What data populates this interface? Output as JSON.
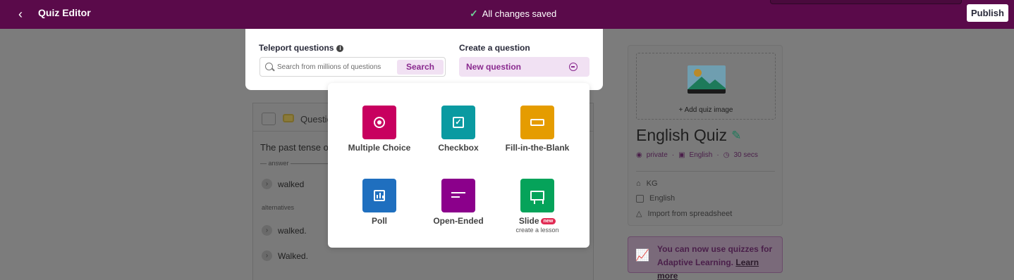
{
  "header": {
    "title": "Quiz Editor",
    "save_status": "All changes saved",
    "publish_label": "Publish"
  },
  "teleport": {
    "label": "Teleport questions",
    "placeholder": "Search from millions of questions",
    "search_label": "Search"
  },
  "create": {
    "label": "Create a question",
    "new_question_label": "New question"
  },
  "question_types": [
    {
      "name": "Multiple Choice",
      "icon": "radio-target-icon",
      "color": "#c8005f"
    },
    {
      "name": "Checkbox",
      "icon": "checkbox-icon",
      "color": "#0a9aa1"
    },
    {
      "name": "Fill-in-the-Blank",
      "icon": "blank-box-icon",
      "color": "#e59c00"
    },
    {
      "name": "Poll",
      "icon": "bar-chart-icon",
      "color": "#1f6fbf"
    },
    {
      "name": "Open-Ended",
      "icon": "text-lines-icon",
      "color": "#8b008b"
    },
    {
      "name": "Slide",
      "icon": "presentation-board-icon",
      "color": "#05a35a",
      "badge": "new",
      "subtitle": "create a lesson"
    }
  ],
  "question_card": {
    "header_label": "Questio",
    "text": "The past tense o",
    "answer_label": "answer",
    "answer": "walked",
    "alternatives_label": "alternatives",
    "alternatives": [
      "walked.",
      "Walked."
    ]
  },
  "quiz_panel": {
    "add_image_label": "+ Add quiz image",
    "title": "English Quiz",
    "visibility": "private",
    "language": "English",
    "duration": "30 secs",
    "grade": "KG",
    "subject": "English",
    "import_label": "Import from spreadsheet"
  },
  "adaptive": {
    "text": "You can now use quizzes for Adaptive Learning.",
    "link": "Learn more"
  },
  "colors": {
    "topbar": "#5a0a4a",
    "accent": "#8a2a8f",
    "accent_bg": "#f1e1f3"
  }
}
